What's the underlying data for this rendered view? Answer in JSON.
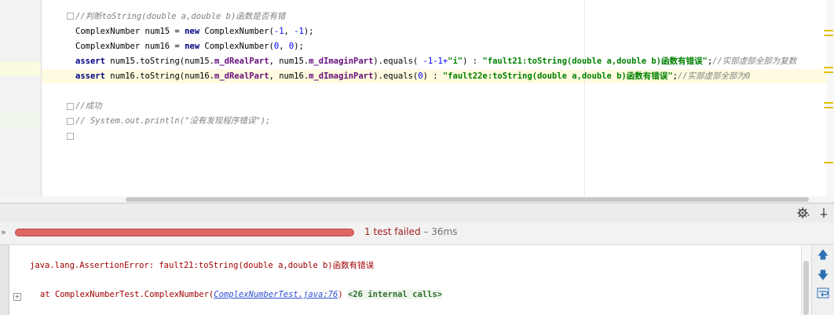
{
  "editor": {
    "lines": [
      {
        "segments": [
          {
            "cls": "cm",
            "text": "//判断toString(double a,double b)函数是否有错"
          }
        ]
      },
      {
        "segments": [
          {
            "cls": "",
            "text": "ComplexNumber num15 = "
          },
          {
            "cls": "kw",
            "text": "new"
          },
          {
            "cls": "",
            "text": " ComplexNumber("
          },
          {
            "cls": "num",
            "text": "-1"
          },
          {
            "cls": "",
            "text": ", "
          },
          {
            "cls": "num",
            "text": "-1"
          },
          {
            "cls": "",
            "text": ");"
          }
        ]
      },
      {
        "segments": [
          {
            "cls": "",
            "text": "ComplexNumber num16 = "
          },
          {
            "cls": "kw",
            "text": "new"
          },
          {
            "cls": "",
            "text": " ComplexNumber("
          },
          {
            "cls": "num",
            "text": "0"
          },
          {
            "cls": "",
            "text": ", "
          },
          {
            "cls": "num",
            "text": "0"
          },
          {
            "cls": "",
            "text": ");"
          }
        ]
      },
      {
        "segments": [
          {
            "cls": "kw",
            "text": "assert"
          },
          {
            "cls": "",
            "text": " num15.toString(num15."
          },
          {
            "cls": "fld",
            "text": "m_dRealPart"
          },
          {
            "cls": "",
            "text": ", num15."
          },
          {
            "cls": "fld",
            "text": "m_dImaginPart"
          },
          {
            "cls": "",
            "text": ").equals( "
          },
          {
            "cls": "num",
            "text": "-1-1+"
          },
          {
            "cls": "str",
            "text": "\"i\""
          },
          {
            "cls": "",
            "text": ") : "
          },
          {
            "cls": "str",
            "text": "\"fault21:toString(double a,double b)函数有错误\""
          },
          {
            "cls": "",
            "text": ";"
          },
          {
            "cls": "cm",
            "text": "//实部虚部全部为复数"
          }
        ]
      },
      {
        "segments": [
          {
            "cls": "kw",
            "text": "assert"
          },
          {
            "cls": "",
            "text": " num16.toString(num16."
          },
          {
            "cls": "fld",
            "text": "m_dRealPart"
          },
          {
            "cls": "",
            "text": ", num16."
          },
          {
            "cls": "fld",
            "text": "m_dImaginPart"
          },
          {
            "cls": "",
            "text": ").equals("
          },
          {
            "cls": "num",
            "text": "0"
          },
          {
            "cls": "",
            "text": ") : "
          },
          {
            "cls": "str",
            "text": "\"fault22e:toString(double a,double b)函数有错误\""
          },
          {
            "cls": "",
            "text": ";"
          },
          {
            "cls": "cm",
            "text": "//实部虚部全部为0"
          }
        ]
      },
      {
        "segments": []
      },
      {
        "segments": [
          {
            "cls": "cm",
            "text": "//成功"
          }
        ]
      },
      {
        "segments": [
          {
            "cls": "cm",
            "text": "// System.out.println(\"没有发现程序错误\");"
          }
        ]
      }
    ]
  },
  "test_run": {
    "status": "1 test failed",
    "duration": " – 36ms",
    "progress_color": "#e06666",
    "progress_fraction": 1.0
  },
  "console": {
    "error_line": "java.lang.AssertionError: fault21:toString(double a,double b)函数有错误",
    "trace_prefix": "at ComplexNumberTest.ComplexNumber(",
    "trace_link": "ComplexNumberTest.java:76",
    "trace_suffix": ") ",
    "internal_calls": "<26 internal calls>",
    "expand_symbol": "+"
  },
  "toolbar": {
    "settings_icon": "gear-icon",
    "pin_icon": "pin-icon",
    "up_icon": "arrow-up-icon",
    "down_icon": "arrow-down-icon",
    "wrap_icon": "soft-wrap-icon",
    "chevron": "»"
  }
}
